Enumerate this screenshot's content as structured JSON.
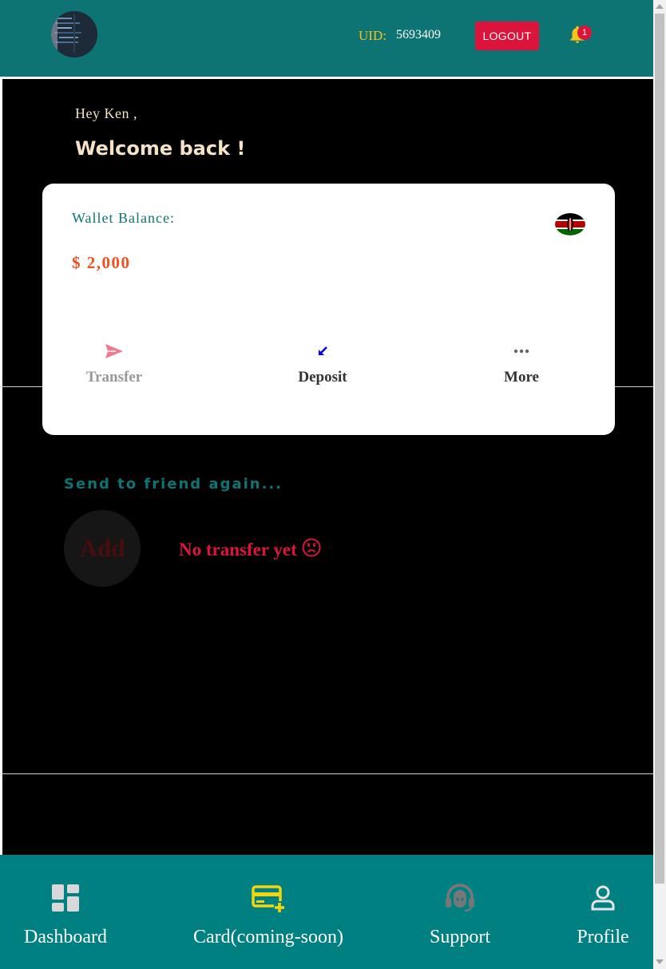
{
  "header": {
    "uid_label": "UID:",
    "uid_value": "5693409",
    "logout_label": "LOGOUT",
    "notification_count": "1",
    "bg_color": "#0e7373"
  },
  "greeting": {
    "hello": "Hey Ken ,",
    "welcome": "Welcome back !"
  },
  "wallet": {
    "label": "Wallet Balance:",
    "balance": "$ 2,000",
    "flag_icon": "kenya-flag-icon",
    "actions": [
      {
        "label": "Transfer",
        "icon": "send-icon",
        "color": "#999999"
      },
      {
        "label": "Deposit",
        "icon": "arrow-down-left-icon",
        "color": "#333333"
      },
      {
        "label": "More",
        "icon": "more-dots-icon",
        "color": "#333333"
      }
    ]
  },
  "friends": {
    "title": "Send to friend again...",
    "add_label": "Add",
    "empty_message": "No transfer yet",
    "empty_emoji": "sad-face-icon"
  },
  "bottom_nav": {
    "items": [
      {
        "label": "Dashboard",
        "icon": "dashboard-icon"
      },
      {
        "label": "Card(coming-soon)",
        "icon": "card-add-icon"
      },
      {
        "label": "Support",
        "icon": "headset-icon"
      },
      {
        "label": "Profile",
        "icon": "person-icon"
      }
    ],
    "bg_color": "#008080"
  }
}
